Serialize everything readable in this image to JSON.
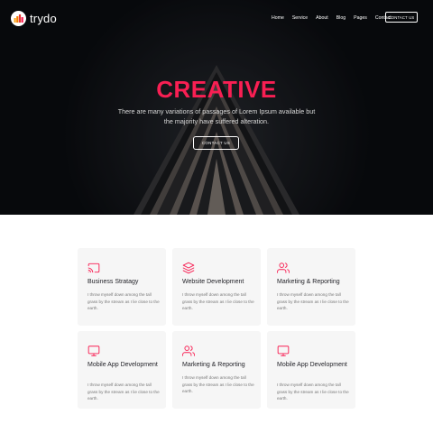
{
  "brand": {
    "name": "trydo"
  },
  "nav": {
    "items": [
      "Home",
      "Service",
      "About",
      "Blog",
      "Pages",
      "Contact"
    ],
    "cta": "CONTACT US"
  },
  "hero": {
    "title": "CREATIVE",
    "subtitle": "There are many variations of passages of Lorem Ipsum available but the majority have suffered alteration.",
    "button": "CONTACT US"
  },
  "services": [
    {
      "icon": "cast-icon",
      "title": "Business Stratagy",
      "description": "I throw myself down among the tall grass by the stream as I lie close to the earth."
    },
    {
      "icon": "layers-icon",
      "title": "Website Development",
      "description": "I throw myself down among the tall grass by the stream as I lie close to the earth."
    },
    {
      "icon": "users-icon",
      "title": "Marketing & Reporting",
      "description": "I throw myself down among the tall grass by the stream as I lie close to the earth."
    },
    {
      "icon": "monitor-icon",
      "title": "Mobile App Development",
      "description": "I throw myself down among the tall grass by the stream as I lie close to the earth."
    },
    {
      "icon": "users-icon",
      "title": "Marketing & Reporting",
      "description": "I throw myself down among the tall grass by the stream as I lie close to the earth."
    },
    {
      "icon": "monitor-icon",
      "title": "Mobile App Development",
      "description": "I throw myself down among the tall grass by the stream as I lie close to the earth."
    }
  ],
  "colors": {
    "accent": "#f81f53",
    "hero_bg": "#0d0f14",
    "card_bg": "#f6f6f6"
  }
}
